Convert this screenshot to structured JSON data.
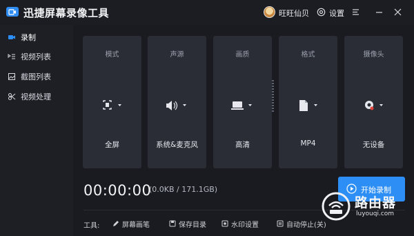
{
  "app": {
    "title": "迅捷屏幕录像工具",
    "user_name": "旺旺仙贝",
    "settings_label": "设置"
  },
  "sidebar": {
    "items": [
      {
        "label": "录制",
        "icon": "camera-icon",
        "active": true
      },
      {
        "label": "视频列表",
        "icon": "video-list-icon",
        "active": false
      },
      {
        "label": "截图列表",
        "icon": "image-list-icon",
        "active": false
      },
      {
        "label": "视频处理",
        "icon": "video-process-icon",
        "active": false
      }
    ]
  },
  "cards": [
    {
      "title": "模式",
      "value": "全屏",
      "icon": "fullscreen-icon"
    },
    {
      "title": "声源",
      "value": "系统&麦克风",
      "icon": "speaker-icon"
    },
    {
      "title": "画质",
      "value": "高清",
      "icon": "monitor-icon"
    },
    {
      "title": "格式",
      "value": "MP4",
      "icon": "file-icon"
    },
    {
      "title": "摄像头",
      "value": "无设备",
      "icon": "webcam-icon"
    }
  ],
  "recording": {
    "timer": "00:00:00",
    "size": "(0.0KB / 171.1GB)",
    "start_label": "开始录制"
  },
  "toolbar": {
    "label": "工具:",
    "items": [
      {
        "label": "屏幕画笔",
        "icon": "pen-icon"
      },
      {
        "label": "保存目录",
        "icon": "folder-icon"
      },
      {
        "label": "水印设置",
        "icon": "watermark-icon"
      },
      {
        "label": "自动停止(关)",
        "icon": "pause-icon"
      }
    ]
  },
  "watermark": {
    "brand": "路由器",
    "url": "luyouqi.com"
  },
  "colors": {
    "accent": "#2d8ef5",
    "background": "#191b20",
    "card": "#2a2d35"
  }
}
